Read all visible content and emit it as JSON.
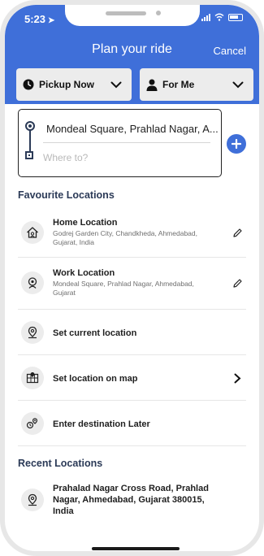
{
  "status": {
    "time": "5:23"
  },
  "header": {
    "title": "Plan your ride",
    "cancel_label": "Cancel"
  },
  "options": {
    "pickup_time_label": "Pickup Now",
    "rider_label": "For Me"
  },
  "route": {
    "pickup_value": "Mondeal Square, Prahlad Nagar, A...",
    "destination_placeholder": "Where to?"
  },
  "favourites": {
    "heading": "Favourite Locations",
    "items": [
      {
        "title": "Home Location",
        "address": "Godrej Garden City, Chandkheda, Ahmedabad, Gujarat, India",
        "icon": "home-icon",
        "action": "edit-icon"
      },
      {
        "title": "Work Location",
        "address": "Mondeal Square, Prahlad Nagar, Ahmedabad, Gujarat",
        "icon": "briefcase-icon",
        "action": "edit-icon"
      }
    ],
    "actions": [
      {
        "label": "Set current location",
        "icon": "location-pin-icon"
      },
      {
        "label": "Set location on map",
        "icon": "map-icon",
        "action": "chevron-right-icon"
      },
      {
        "label": "Enter destination Later",
        "icon": "later-icon"
      }
    ]
  },
  "recent": {
    "heading": "Recent Locations",
    "items": [
      {
        "address": "Prahalad Nagar Cross Road, Prahlad Nagar, Ahmedabad, Gujarat 380015, India",
        "icon": "location-pin-icon"
      }
    ]
  },
  "colors": {
    "header": "#3f6fd9",
    "accent": "#3f6fd9",
    "heading": "#2b3a57"
  }
}
